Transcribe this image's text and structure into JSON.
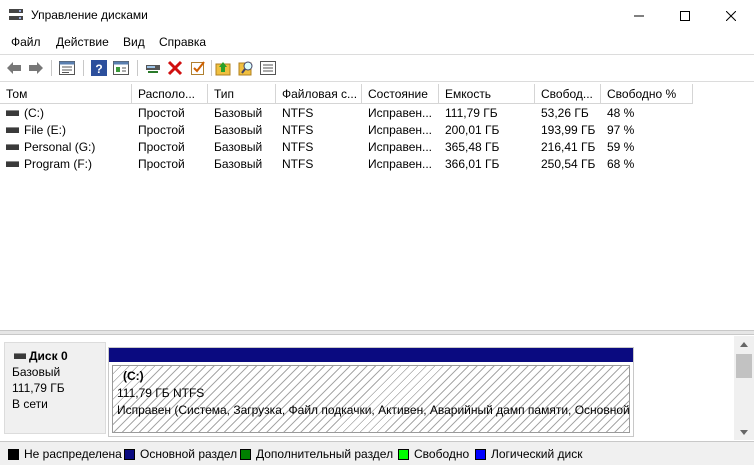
{
  "window": {
    "title": "Управление дисками"
  },
  "menu": [
    "Файл",
    "Действие",
    "Вид",
    "Справка"
  ],
  "toolbar": {
    "icons": [
      "back-icon",
      "forward-icon",
      "properties-icon",
      "help-icon",
      "console-icon",
      "connect-icon",
      "delete-icon",
      "check-icon",
      "folder-up-icon",
      "search-icon",
      "list-icon"
    ]
  },
  "columns": [
    "Том",
    "Располо...",
    "Тип",
    "Файловая с...",
    "Состояние",
    "Емкость",
    "Свобод...",
    "Свободно %"
  ],
  "volumes": [
    {
      "name": "(C:)",
      "layout": "Простой",
      "type": "Базовый",
      "fs": "NTFS",
      "status": "Исправен...",
      "capacity": "111,79 ГБ",
      "free": "53,26 ГБ",
      "pct": "48 %"
    },
    {
      "name": "File (E:)",
      "layout": "Простой",
      "type": "Базовый",
      "fs": "NTFS",
      "status": "Исправен...",
      "capacity": "200,01 ГБ",
      "free": "193,99 ГБ",
      "pct": "97 %"
    },
    {
      "name": "Personal (G:)",
      "layout": "Простой",
      "type": "Базовый",
      "fs": "NTFS",
      "status": "Исправен...",
      "capacity": "365,48 ГБ",
      "free": "216,41 ГБ",
      "pct": "59 %"
    },
    {
      "name": "Program (F:)",
      "layout": "Простой",
      "type": "Базовый",
      "fs": "NTFS",
      "status": "Исправен...",
      "capacity": "366,01 ГБ",
      "free": "250,54 ГБ",
      "pct": "68 %"
    }
  ],
  "disk": {
    "name": "Диск 0",
    "type": "Базовый",
    "size": "111,79 ГБ",
    "status": "В сети",
    "partition": {
      "name": "(C:)",
      "size_fs": "111,79 ГБ NTFS",
      "status": "Исправен (Система, Загрузка, Файл подкачки, Активен, Аварийный дамп памяти, Основной"
    }
  },
  "legend": [
    {
      "label": "Не распределена",
      "color": "#000000"
    },
    {
      "label": "Основной раздел",
      "color": "#0a0a80"
    },
    {
      "label": "Дополнительный раздел",
      "color": "#008000"
    },
    {
      "label": "Свободно",
      "color": "#00ff00"
    },
    {
      "label": "Логический диск",
      "color": "#0000ff"
    }
  ]
}
